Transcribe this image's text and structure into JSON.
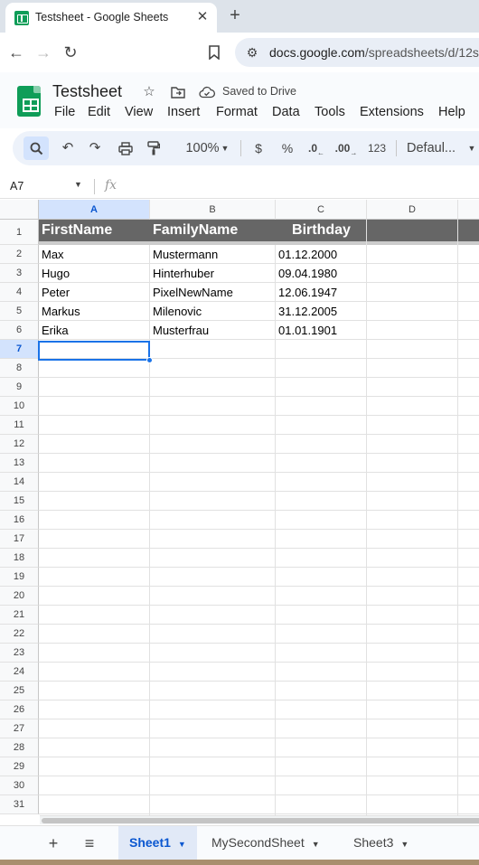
{
  "browser": {
    "tab_title": "Testsheet - Google Sheets",
    "close_glyph": "✕",
    "new_tab_glyph": "+",
    "url_host": "docs.google.com",
    "url_path": "/spreadsheets/d/12s"
  },
  "doc": {
    "title": "Testsheet",
    "saved_status": "Saved to Drive",
    "menu": [
      "File",
      "Edit",
      "View",
      "Insert",
      "Format",
      "Data",
      "Tools",
      "Extensions",
      "Help"
    ]
  },
  "toolbar": {
    "zoom": "100%",
    "currency": "$",
    "percent": "%",
    "decrease_decimals": ".0",
    "increase_decimals": ".00",
    "more_formats": "123",
    "font": "Defaul..."
  },
  "formula_bar": {
    "name_box": "A7",
    "fx_glyph": "fx",
    "value": ""
  },
  "grid": {
    "columns": [
      "A",
      "B",
      "C",
      "D"
    ],
    "selected_column": "A",
    "selected_row": "7",
    "row_numbers": [
      "1",
      "2",
      "3",
      "4",
      "5",
      "6",
      "7",
      "8",
      "9",
      "10",
      "11",
      "12",
      "13",
      "14",
      "15",
      "16",
      "17",
      "18",
      "19",
      "20",
      "21",
      "22",
      "23",
      "24",
      "25",
      "26",
      "27",
      "28",
      "29",
      "30",
      "31"
    ],
    "header": [
      "FirstName",
      "FamilyName",
      "Birthday"
    ],
    "rows": [
      [
        "Max",
        "Mustermann",
        "01.12.2000"
      ],
      [
        "Hugo",
        "Hinterhuber",
        "09.04.1980"
      ],
      [
        "Peter",
        "PixelNewName",
        "12.06.1947"
      ],
      [
        "Markus",
        "Milenovic",
        "31.12.2005"
      ],
      [
        "Erika",
        "Musterfrau",
        "01.01.1901"
      ]
    ],
    "header_bg": "#666666",
    "selection_color": "#1a73e8"
  },
  "sheets": {
    "tabs": [
      "Sheet1",
      "MySecondSheet",
      "Sheet3"
    ],
    "active": "Sheet1"
  },
  "colors": {
    "sheets_green": "#0f9d58",
    "accent_blue": "#0b57d0"
  }
}
